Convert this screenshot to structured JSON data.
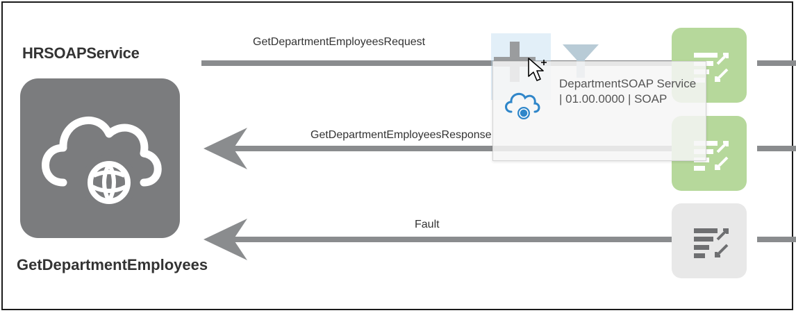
{
  "service": {
    "name": "HRSOAPService",
    "operation": "GetDepartmentEmployees",
    "icon": "cloud-globe-icon"
  },
  "flows": {
    "request_label": "GetDepartmentEmployeesRequest",
    "response_label": "GetDepartmentEmployeesResponse",
    "fault_label": "Fault"
  },
  "drag_overlay": {
    "text": "DepartmentSOAP Service | 01.00.0000 | SOAP",
    "icon": "cloud-globe-icon"
  },
  "icons": {
    "add": "plus-icon",
    "filter": "funnel-icon",
    "cursor": "add-cursor-icon",
    "mapper": "mapper-icon"
  },
  "colors": {
    "tile_gray": "#7b7c7e",
    "wire_gray": "#8a8c8e",
    "mapper_green": "#b6d89b",
    "mapper_disabled": "#e8e8e8",
    "overlay_blue": "#2f86c9"
  }
}
